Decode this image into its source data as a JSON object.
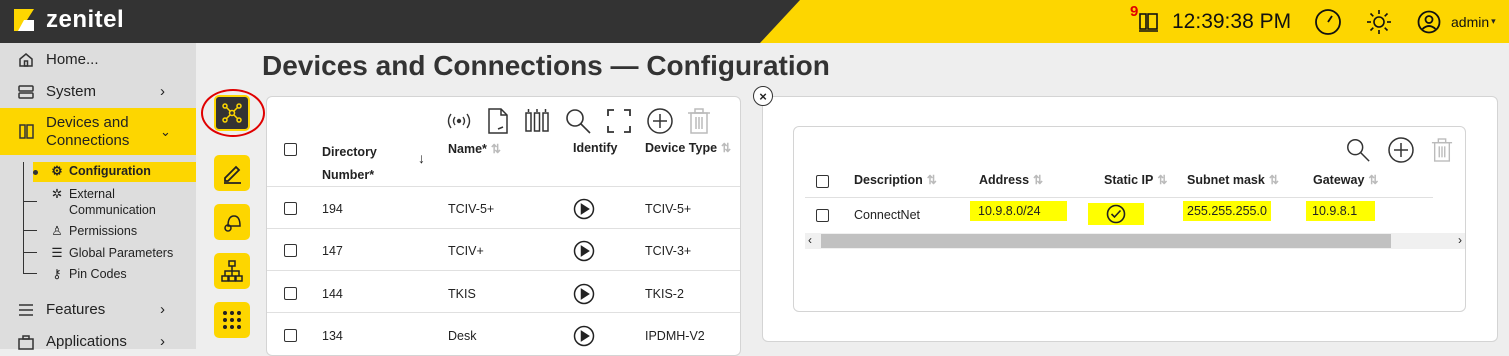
{
  "header": {
    "logo_text": "zenitel",
    "notification_count": "9",
    "clock": "12:39:38 PM",
    "user": "admin"
  },
  "sidebar": {
    "items": [
      {
        "label": "Home..."
      },
      {
        "label": "System"
      },
      {
        "label": "Devices and Connections"
      },
      {
        "label": "Features"
      },
      {
        "label": "Applications"
      }
    ],
    "sub": [
      {
        "label": "Configuration"
      },
      {
        "label": "External Communication"
      },
      {
        "label": "Permissions"
      },
      {
        "label": "Global Parameters"
      },
      {
        "label": "Pin Codes"
      }
    ]
  },
  "page": {
    "title": "Devices and Connections — Configuration"
  },
  "devices": {
    "headers": {
      "directory": "Directory",
      "number": "Number*",
      "name": "Name*",
      "identify": "Identify",
      "type": "Device Type"
    },
    "rows": [
      {
        "dir": "194",
        "name": "TCIV-5+",
        "type": "TCIV-5+"
      },
      {
        "dir": "147",
        "name": "TCIV+",
        "type": "TCIV-3+"
      },
      {
        "dir": "144",
        "name": "TKIS",
        "type": "TKIS-2"
      },
      {
        "dir": "134",
        "name": "Desk",
        "type": "IPDMH-V2"
      }
    ]
  },
  "connections": {
    "headers": {
      "description": "Description",
      "address": "Address",
      "static": "Static IP",
      "subnet": "Subnet mask",
      "gateway": "Gateway"
    },
    "rows": [
      {
        "description": "ConnectNet",
        "address": "10.9.8.0/24",
        "subnet": "255.255.255.0",
        "gateway": "10.9.8.1"
      }
    ]
  }
}
